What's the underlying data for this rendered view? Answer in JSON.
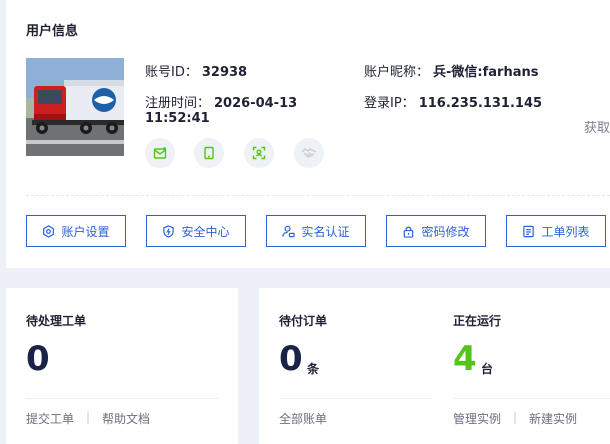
{
  "user": {
    "title": "用户信息",
    "id_label": "账号ID：",
    "id_value": "32938",
    "nick_label": "账户昵称：",
    "nick_value": "兵-微信:farhans",
    "reg_label": "注册时间：",
    "reg_date": "2026-04-13",
    "reg_time": "11:52:41",
    "ip_label": "登录IP：",
    "ip_value": "116.235.131.145",
    "fetch_label": "获取"
  },
  "badges": [
    "email-verified-icon",
    "phone-verified-icon",
    "face-scan-icon",
    "handshake-icon"
  ],
  "actions": {
    "account_settings": "账户设置",
    "security_center": "安全中心",
    "real_name": "实名认证",
    "password_change": "密码修改",
    "ticket_list": "工单列表"
  },
  "tickets": {
    "title": "待处理工单",
    "count": "0",
    "submit_link": "提交工单",
    "help_link": "帮助文档"
  },
  "orders": {
    "title": "待付订单",
    "count": "0",
    "unit": "条",
    "all_link": "全部账单"
  },
  "running": {
    "title": "正在运行",
    "count": "4",
    "unit": "台",
    "manage_link": "管理实例",
    "new_link": "新建实例"
  },
  "colors": {
    "accent": "#2b62d9",
    "running": "#52c41a",
    "badge_green": "#52c41a",
    "badge_gray": "#c9cdd6"
  }
}
